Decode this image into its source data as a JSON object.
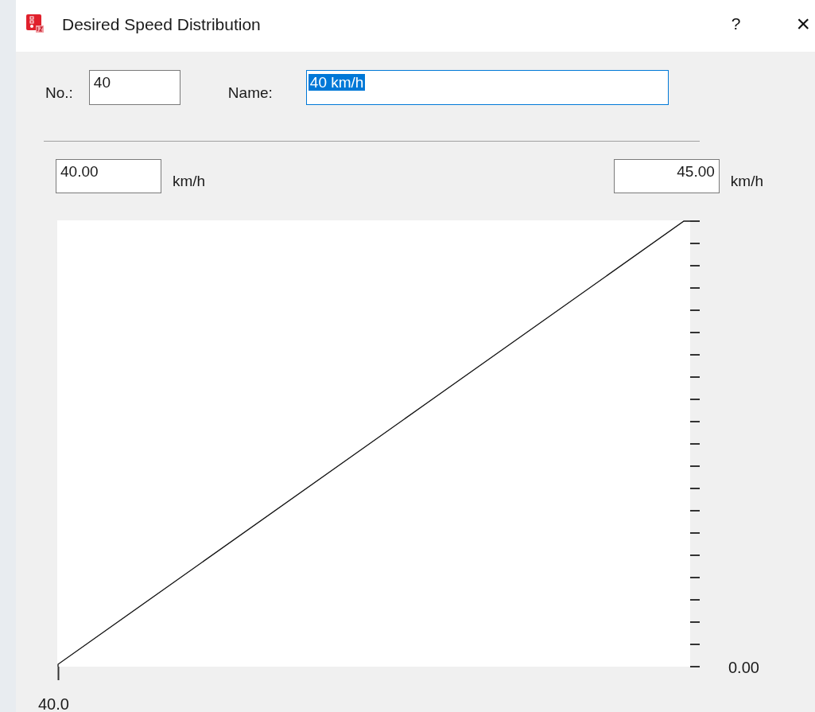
{
  "window": {
    "title": "Desired Speed Distribution",
    "buttons": [
      "?",
      "×"
    ]
  },
  "fields": [
    {
      "label": "No.:",
      "value": "40",
      "focused": false,
      "text_selected": false
    },
    {
      "label": "Name:",
      "value": "40 km/h",
      "focused": true,
      "text_selected": true
    }
  ],
  "range": [
    {
      "value": "40.00",
      "unit": "km/h"
    },
    {
      "value": "45.00",
      "unit": "km/h"
    }
  ],
  "chart": {
    "y_axis_label": "0.00",
    "x_axis_label": "40.0"
  }
}
